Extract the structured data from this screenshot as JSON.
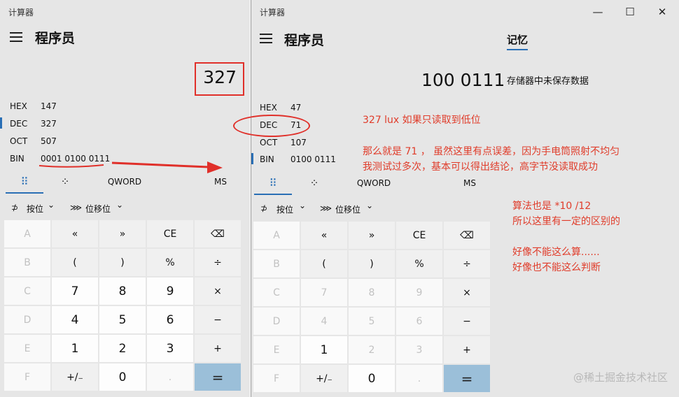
{
  "left": {
    "title": "计算器",
    "mode": "程序员",
    "display": "327",
    "radix": [
      {
        "label": "HEX",
        "value": "147"
      },
      {
        "label": "DEC",
        "value": "327"
      },
      {
        "label": "OCT",
        "value": "507"
      },
      {
        "label": "BIN",
        "value": "0001 0100 0111"
      }
    ],
    "tabs": {
      "keypad": "⠿",
      "bitflip": "⁘",
      "word": "QWORD",
      "ms": "MS"
    },
    "ops": {
      "bitwise_icon": "⊅",
      "bitwise": "按位",
      "shift_icon": "⋙",
      "shift": "位移位",
      "caret": "⌄"
    },
    "keys": [
      {
        "t": "A",
        "k": "dis"
      },
      {
        "t": "«",
        "k": "op"
      },
      {
        "t": "»",
        "k": "op"
      },
      {
        "t": "CE",
        "k": "op"
      },
      {
        "t": "⌫",
        "k": "op"
      },
      {
        "t": "B",
        "k": "dis"
      },
      {
        "t": "(",
        "k": "op"
      },
      {
        "t": ")",
        "k": "op"
      },
      {
        "t": "%",
        "k": "op"
      },
      {
        "t": "÷",
        "k": "op"
      },
      {
        "t": "C",
        "k": "dis"
      },
      {
        "t": "7",
        "k": "num"
      },
      {
        "t": "8",
        "k": "num"
      },
      {
        "t": "9",
        "k": "num"
      },
      {
        "t": "×",
        "k": "op"
      },
      {
        "t": "D",
        "k": "dis"
      },
      {
        "t": "4",
        "k": "num"
      },
      {
        "t": "5",
        "k": "num"
      },
      {
        "t": "6",
        "k": "num"
      },
      {
        "t": "−",
        "k": "op"
      },
      {
        "t": "E",
        "k": "dis"
      },
      {
        "t": "1",
        "k": "num"
      },
      {
        "t": "2",
        "k": "num"
      },
      {
        "t": "3",
        "k": "num"
      },
      {
        "t": "+",
        "k": "op"
      },
      {
        "t": "F",
        "k": "dis"
      },
      {
        "t": "+/₋",
        "k": "op"
      },
      {
        "t": "0",
        "k": "num"
      },
      {
        "t": ".",
        "k": "dis"
      },
      {
        "t": "=",
        "k": "eq"
      }
    ]
  },
  "right": {
    "title": "计算器",
    "controls": {
      "minimize": "—",
      "maximize": "☐",
      "close": "✕"
    },
    "mode": "程序员",
    "memory_tab": "记忆",
    "memory_empty": "存储器中未保存数据",
    "display": "100 0111",
    "radix": [
      {
        "label": "HEX",
        "value": "47"
      },
      {
        "label": "DEC",
        "value": "71"
      },
      {
        "label": "OCT",
        "value": "107"
      },
      {
        "label": "BIN",
        "value": "0100 0111"
      }
    ],
    "tabs": {
      "keypad": "⠿",
      "bitflip": "⁘",
      "word": "QWORD",
      "ms": "MS"
    },
    "ops": {
      "bitwise_icon": "⊅",
      "bitwise": "按位",
      "shift_icon": "⋙",
      "shift": "位移位",
      "caret": "⌄"
    },
    "keys": [
      {
        "t": "A",
        "k": "dis"
      },
      {
        "t": "«",
        "k": "op"
      },
      {
        "t": "»",
        "k": "op"
      },
      {
        "t": "CE",
        "k": "op"
      },
      {
        "t": "⌫",
        "k": "op"
      },
      {
        "t": "B",
        "k": "dis"
      },
      {
        "t": "(",
        "k": "op"
      },
      {
        "t": ")",
        "k": "op"
      },
      {
        "t": "%",
        "k": "op"
      },
      {
        "t": "÷",
        "k": "op"
      },
      {
        "t": "C",
        "k": "dis"
      },
      {
        "t": "7",
        "k": "dis"
      },
      {
        "t": "8",
        "k": "dis"
      },
      {
        "t": "9",
        "k": "dis"
      },
      {
        "t": "×",
        "k": "op"
      },
      {
        "t": "D",
        "k": "dis"
      },
      {
        "t": "4",
        "k": "dis"
      },
      {
        "t": "5",
        "k": "dis"
      },
      {
        "t": "6",
        "k": "dis"
      },
      {
        "t": "−",
        "k": "op"
      },
      {
        "t": "E",
        "k": "dis"
      },
      {
        "t": "1",
        "k": "num"
      },
      {
        "t": "2",
        "k": "dis"
      },
      {
        "t": "3",
        "k": "dis"
      },
      {
        "t": "+",
        "k": "op"
      },
      {
        "t": "F",
        "k": "dis"
      },
      {
        "t": "+/₋",
        "k": "op"
      },
      {
        "t": "0",
        "k": "num"
      },
      {
        "t": ".",
        "k": "dis"
      },
      {
        "t": "=",
        "k": "eq"
      }
    ]
  },
  "annotations": {
    "line1": "327 lux 如果只读取到低位",
    "line2": "那么就是 71 ， 虽然这里有点误差，因为手电筒照射不均匀",
    "line3": "我测试过多次，基本可以得出结论，高字节没读取成功",
    "line4": "算法也是 *10 /12",
    "line5": "所以这里有一定的区别的",
    "line6": "好像不能这么算......",
    "line7": "好像也不能这么判断"
  },
  "watermark": "@稀土掘金技术社区",
  "colors": {
    "annotation": "#e03c2a",
    "accent": "#2a6fb5",
    "equals": "#9bbfd9"
  }
}
